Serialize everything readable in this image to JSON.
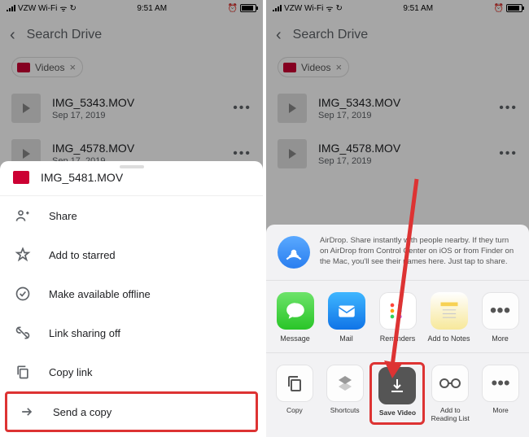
{
  "status": {
    "carrier": "VZW Wi-Fi",
    "time": "9:51 AM"
  },
  "drive": {
    "search_placeholder": "Search Drive",
    "chip_label": "Videos",
    "files": [
      {
        "name": "IMG_5343.MOV",
        "date": "Sep 17, 2019"
      },
      {
        "name": "IMG_4578.MOV",
        "date": "Sep 17, 2019"
      }
    ]
  },
  "context_menu": {
    "file": "IMG_5481.MOV",
    "items": {
      "share": "Share",
      "starred": "Add to starred",
      "offline": "Make available offline",
      "link_sharing": "Link sharing off",
      "copy_link": "Copy link",
      "send_copy": "Send a copy"
    }
  },
  "share_sheet": {
    "airdrop": "AirDrop. Share instantly with people nearby. If they turn on AirDrop from Control Center on iOS or from Finder on the Mac, you'll see their names here. Just tap to share.",
    "apps": {
      "message": "Message",
      "mail": "Mail",
      "reminders": "Reminders",
      "notes": "Add to Notes",
      "more": "More"
    },
    "actions": {
      "copy": "Copy",
      "shortcuts": "Shortcuts",
      "save_video": "Save Video",
      "reading_list": "Add to Reading List",
      "more": "More"
    }
  }
}
